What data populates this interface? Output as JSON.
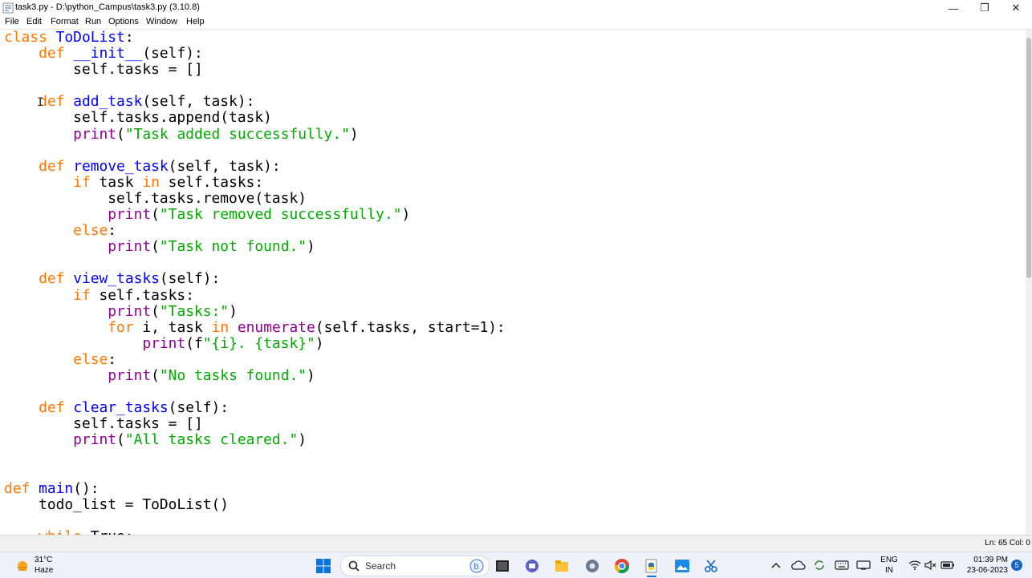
{
  "window": {
    "title": "task3.py - D:\\python_Campus\\task3.py (3.10.8)",
    "minimize_glyph": "—",
    "maximize_glyph": "❐",
    "close_glyph": "✕"
  },
  "menu": [
    "File",
    "Edit",
    "Format",
    "Run",
    "Options",
    "Window",
    "Help"
  ],
  "code_lines": [
    [
      [
        "class ",
        "kw"
      ],
      [
        "ToDoList",
        "df"
      ],
      [
        ":",
        ""
      ]
    ],
    [
      [
        "    ",
        ""
      ],
      [
        "def ",
        "kw"
      ],
      [
        "__init__",
        "df"
      ],
      [
        "(self):",
        ""
      ]
    ],
    [
      [
        "        self.tasks = []",
        ""
      ]
    ],
    [
      [
        "",
        ""
      ]
    ],
    [
      [
        "    ",
        ""
      ],
      [
        "def ",
        "kw"
      ],
      [
        "add_task",
        "df"
      ],
      [
        "(self, task):",
        ""
      ]
    ],
    [
      [
        "        self.tasks.append(task)",
        ""
      ]
    ],
    [
      [
        "        ",
        ""
      ],
      [
        "print",
        "bi"
      ],
      [
        "(",
        ""
      ],
      [
        "\"Task added successfully.\"",
        "st"
      ],
      [
        ")",
        ""
      ]
    ],
    [
      [
        "",
        ""
      ]
    ],
    [
      [
        "    ",
        ""
      ],
      [
        "def ",
        "kw"
      ],
      [
        "remove_task",
        "df"
      ],
      [
        "(self, task):",
        ""
      ]
    ],
    [
      [
        "        ",
        ""
      ],
      [
        "if",
        "kw"
      ],
      [
        " task ",
        ""
      ],
      [
        "in",
        "kw"
      ],
      [
        " self.tasks:",
        ""
      ]
    ],
    [
      [
        "            self.tasks.remove(task)",
        ""
      ]
    ],
    [
      [
        "            ",
        ""
      ],
      [
        "print",
        "bi"
      ],
      [
        "(",
        ""
      ],
      [
        "\"Task removed successfully.\"",
        "st"
      ],
      [
        ")",
        ""
      ]
    ],
    [
      [
        "        ",
        ""
      ],
      [
        "else",
        "kw"
      ],
      [
        ":",
        ""
      ]
    ],
    [
      [
        "            ",
        ""
      ],
      [
        "print",
        "bi"
      ],
      [
        "(",
        ""
      ],
      [
        "\"Task not found.\"",
        "st"
      ],
      [
        ")",
        ""
      ]
    ],
    [
      [
        "",
        ""
      ]
    ],
    [
      [
        "    ",
        ""
      ],
      [
        "def ",
        "kw"
      ],
      [
        "view_tasks",
        "df"
      ],
      [
        "(self):",
        ""
      ]
    ],
    [
      [
        "        ",
        ""
      ],
      [
        "if",
        "kw"
      ],
      [
        " self.tasks:",
        ""
      ]
    ],
    [
      [
        "            ",
        ""
      ],
      [
        "print",
        "bi"
      ],
      [
        "(",
        ""
      ],
      [
        "\"Tasks:\"",
        "st"
      ],
      [
        ")",
        ""
      ]
    ],
    [
      [
        "            ",
        ""
      ],
      [
        "for",
        "kw"
      ],
      [
        " i, task ",
        ""
      ],
      [
        "in",
        "kw"
      ],
      [
        " ",
        ""
      ],
      [
        "enumerate",
        "bi"
      ],
      [
        "(self.tasks, start=1):",
        ""
      ]
    ],
    [
      [
        "                ",
        ""
      ],
      [
        "print",
        "bi"
      ],
      [
        "(f",
        ""
      ],
      [
        "\"{i}. {task}\"",
        "st"
      ],
      [
        ")",
        ""
      ]
    ],
    [
      [
        "        ",
        ""
      ],
      [
        "else",
        "kw"
      ],
      [
        ":",
        ""
      ]
    ],
    [
      [
        "            ",
        ""
      ],
      [
        "print",
        "bi"
      ],
      [
        "(",
        ""
      ],
      [
        "\"No tasks found.\"",
        "st"
      ],
      [
        ")",
        ""
      ]
    ],
    [
      [
        "",
        ""
      ]
    ],
    [
      [
        "    ",
        ""
      ],
      [
        "def ",
        "kw"
      ],
      [
        "clear_tasks",
        "df"
      ],
      [
        "(self):",
        ""
      ]
    ],
    [
      [
        "        self.tasks = []",
        ""
      ]
    ],
    [
      [
        "        ",
        ""
      ],
      [
        "print",
        "bi"
      ],
      [
        "(",
        ""
      ],
      [
        "\"All tasks cleared.\"",
        "st"
      ],
      [
        ")",
        ""
      ]
    ],
    [
      [
        "",
        ""
      ]
    ],
    [
      [
        "",
        ""
      ]
    ],
    [
      [
        "def ",
        "kw"
      ],
      [
        "main",
        "df"
      ],
      [
        "():",
        ""
      ]
    ],
    [
      [
        "    todo_list = ToDoList()",
        ""
      ]
    ],
    [
      [
        "",
        ""
      ]
    ],
    [
      [
        "    ",
        ""
      ],
      [
        "while",
        "kw"
      ],
      [
        " True:",
        ""
      ]
    ]
  ],
  "status": {
    "position": "Ln: 65  Col: 0"
  },
  "taskbar": {
    "weather_temp": "31°C",
    "weather_desc": "Haze",
    "search_placeholder": "Search",
    "lang_line1": "ENG",
    "lang_line2": "IN",
    "time": "01:39 PM",
    "date": "23-06-2023",
    "notification_count": "5"
  },
  "colors": {
    "keyword": "#ff7700",
    "builtin": "#900090",
    "string": "#00aa00",
    "definition": "#0000ff"
  }
}
